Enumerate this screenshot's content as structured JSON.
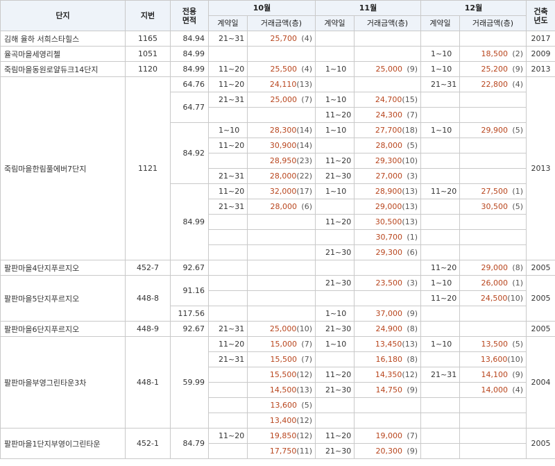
{
  "colors": {
    "header_bg": "#eef3f9",
    "border": "#c9c9c9",
    "amount": "#b8451d"
  },
  "header": {
    "complex": "단지",
    "lot": "지번",
    "area": [
      "전용",
      "면적"
    ],
    "months": [
      "10월",
      "11월",
      "12월"
    ],
    "built": [
      "건축",
      "년도"
    ],
    "sub_period": "계약일",
    "sub_amount": "거래금액(층)"
  },
  "rows": [
    {
      "complex": "김해 율하 서희스타힐스",
      "lot": "1165",
      "area": "84.94",
      "built": "2017",
      "m10": [
        [
          "21~31",
          "25,700",
          "(4)"
        ]
      ],
      "m11": [],
      "m12": []
    },
    {
      "complex": "율곡마을세영리첼",
      "lot": "1051",
      "area": "84.99",
      "built": "2009",
      "m10": [],
      "m11": [],
      "m12": [
        [
          "1~10",
          "18,500",
          "(2)"
        ]
      ]
    },
    {
      "complex": "죽림마을동원로얄듀크14단지",
      "lot": "1120",
      "area": "84.99",
      "built": "2013",
      "m10": [
        [
          "11~20",
          "25,500",
          "(4)"
        ]
      ],
      "m11": [
        [
          "1~10",
          "25,000",
          "(9)"
        ]
      ],
      "m12": [
        [
          "1~10",
          "25,200",
          "(9)"
        ]
      ]
    },
    {
      "complex": "죽림마을한림풀에버7단지",
      "lot": "1121",
      "built": "2013",
      "groups": [
        {
          "area": "64.76",
          "m10": [
            [
              "11~20",
              "24,110",
              "(13)"
            ]
          ],
          "m11": [],
          "m12": [
            [
              "21~31",
              "22,800",
              "(4)"
            ]
          ]
        },
        {
          "area": "64.77",
          "m10": [
            [
              "21~31",
              "25,000",
              "(7)"
            ]
          ],
          "m11": [
            [
              "1~10",
              "24,700",
              "(15)"
            ],
            [
              "11~20",
              "24,300",
              "(7)"
            ]
          ],
          "m12": []
        },
        {
          "area": "84.92",
          "m10": [
            [
              "1~10",
              "28,300",
              "(14)"
            ],
            [
              "11~20",
              "30,900",
              "(14)"
            ],
            [
              "",
              "28,950",
              "(23)"
            ],
            [
              "21~31",
              "28,000",
              "(22)"
            ]
          ],
          "m11": [
            [
              "1~10",
              "27,700",
              "(18)"
            ],
            [
              "",
              "28,000",
              "(5)"
            ],
            [
              "11~20",
              "29,300",
              "(10)"
            ],
            [
              "21~30",
              "27,000",
              "(3)"
            ]
          ],
          "m12": [
            [
              "1~10",
              "29,900",
              "(5)"
            ]
          ]
        },
        {
          "area": "84.99",
          "m10": [
            [
              "11~20",
              "32,000",
              "(17)"
            ],
            [
              "21~31",
              "28,000",
              "(6)"
            ]
          ],
          "m11": [
            [
              "1~10",
              "28,900",
              "(13)"
            ],
            [
              "",
              "29,000",
              "(13)"
            ],
            [
              "11~20",
              "30,500",
              "(13)"
            ],
            [
              "",
              "30,700",
              "(1)"
            ],
            [
              "21~30",
              "29,300",
              "(6)"
            ]
          ],
          "m12": [
            [
              "11~20",
              "27,500",
              "(1)"
            ],
            [
              "",
              "30,500",
              "(5)"
            ]
          ]
        }
      ]
    },
    {
      "complex": "팔판마을4단지푸르지오",
      "lot": "452-7",
      "area": "92.67",
      "built": "2005",
      "m10": [],
      "m11": [],
      "m12": [
        [
          "11~20",
          "29,000",
          "(8)"
        ]
      ]
    },
    {
      "complex": "팔판마을5단지푸르지오",
      "lot": "448-8",
      "built": "2005",
      "groups": [
        {
          "area": "91.16",
          "m10": [],
          "m11": [
            [
              "21~30",
              "23,500",
              "(3)"
            ]
          ],
          "m12": [
            [
              "1~10",
              "26,000",
              "(1)"
            ],
            [
              "11~20",
              "24,500",
              "(10)"
            ]
          ]
        },
        {
          "area": "117.56",
          "m10": [],
          "m11": [
            [
              "1~10",
              "37,000",
              "(9)"
            ]
          ],
          "m12": []
        }
      ]
    },
    {
      "complex": "팔판마을6단지푸르지오",
      "lot": "448-9",
      "area": "92.67",
      "built": "2005",
      "m10": [
        [
          "21~31",
          "25,000",
          "(10)"
        ]
      ],
      "m11": [
        [
          "21~30",
          "24,900",
          "(8)"
        ]
      ],
      "m12": []
    },
    {
      "complex": "팔판마을부영그린타운3차",
      "lot": "448-1",
      "area": "59.99",
      "built": "2004",
      "m10": [
        [
          "11~20",
          "15,000",
          "(7)"
        ],
        [
          "21~31",
          "15,500",
          "(7)"
        ],
        [
          "",
          "15,500",
          "(12)"
        ],
        [
          "",
          "14,500",
          "(13)"
        ],
        [
          "",
          "13,600",
          "(5)"
        ],
        [
          "",
          "13,400",
          "(12)"
        ]
      ],
      "m11": [
        [
          "1~10",
          "13,450",
          "(13)"
        ],
        [
          "",
          "16,180",
          "(8)"
        ],
        [
          "11~20",
          "14,350",
          "(12)"
        ],
        [
          "21~30",
          "14,750",
          "(9)"
        ]
      ],
      "m12": [
        [
          "1~10",
          "13,500",
          "(5)"
        ],
        [
          "",
          "13,600",
          "(10)"
        ],
        [
          "21~31",
          "14,100",
          "(9)"
        ],
        [
          "",
          "14,000",
          "(4)"
        ]
      ]
    },
    {
      "complex": "팔판마을1단지부영이그린타운",
      "lot": "452-1",
      "area": "84.79",
      "built": "2005",
      "m10": [
        [
          "11~20",
          "19,850",
          "(12)"
        ],
        [
          "",
          "17,750",
          "(11)"
        ]
      ],
      "m11": [
        [
          "11~20",
          "19,000",
          "(7)"
        ],
        [
          "21~30",
          "20,300",
          "(9)"
        ]
      ],
      "m12": []
    }
  ]
}
